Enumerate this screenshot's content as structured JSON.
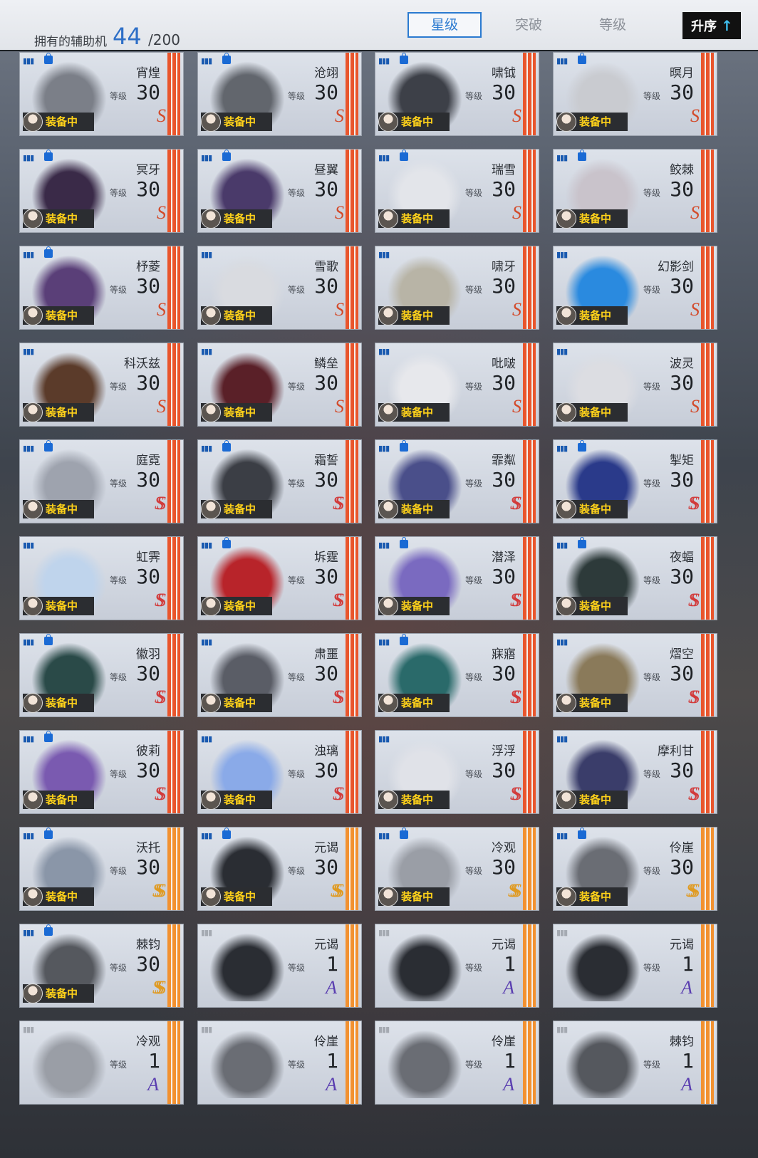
{
  "header": {
    "owned_label": "拥有的辅助机",
    "owned_count": "44",
    "owned_total": "/200",
    "tabs": [
      "星级",
      "突破",
      "等级"
    ],
    "active_tab": "星级",
    "sort_label": "升序",
    "sort_arrow": "↑"
  },
  "colors": {
    "accent": "#2a7ad0",
    "equip_text": "#ffd21a",
    "stripe_red": "#e9552c",
    "stripe_orange": "#f29130"
  },
  "level_label": "等级",
  "equip_label": "装备中",
  "cards": [
    {
      "name": "宵煌",
      "level": "30",
      "rank": "S",
      "equipped": true,
      "locked": true,
      "tint": "#7b7f88"
    },
    {
      "name": "沧翊",
      "level": "30",
      "rank": "S",
      "equipped": true,
      "locked": true,
      "tint": "#62666d"
    },
    {
      "name": "啸钺",
      "level": "30",
      "rank": "S",
      "equipped": true,
      "locked": true,
      "tint": "#3d4048"
    },
    {
      "name": "暝月",
      "level": "30",
      "rank": "S",
      "equipped": true,
      "locked": true,
      "tint": "#c9cbd0"
    },
    {
      "name": "冥牙",
      "level": "30",
      "rank": "S",
      "equipped": true,
      "locked": true,
      "tint": "#3a2a48"
    },
    {
      "name": "昼翼",
      "level": "30",
      "rank": "S",
      "equipped": true,
      "locked": true,
      "tint": "#4a3a6a"
    },
    {
      "name": "瑞雪",
      "level": "30",
      "rank": "S",
      "equipped": true,
      "locked": true,
      "tint": "#e3e5ea"
    },
    {
      "name": "鲛棘",
      "level": "30",
      "rank": "S",
      "equipped": true,
      "locked": true,
      "tint": "#c9c3cb"
    },
    {
      "name": "杼菱",
      "level": "30",
      "rank": "S",
      "equipped": true,
      "locked": true,
      "tint": "#5a3f78"
    },
    {
      "name": "雪歌",
      "level": "30",
      "rank": "S",
      "equipped": true,
      "locked": false,
      "tint": "#d9dbe0"
    },
    {
      "name": "啸牙",
      "level": "30",
      "rank": "S",
      "equipped": true,
      "locked": false,
      "tint": "#b8b4a6"
    },
    {
      "name": "幻影剑",
      "level": "30",
      "rank": "S",
      "equipped": true,
      "locked": false,
      "tint": "#2a8adf"
    },
    {
      "name": "科沃兹",
      "level": "30",
      "rank": "S",
      "equipped": true,
      "locked": false,
      "tint": "#5b3b2a"
    },
    {
      "name": "鳞垒",
      "level": "30",
      "rank": "S",
      "equipped": true,
      "locked": false,
      "tint": "#5a2028"
    },
    {
      "name": "吡啵",
      "level": "30",
      "rank": "S",
      "equipped": true,
      "locked": false,
      "tint": "#e7e8ec"
    },
    {
      "name": "波灵",
      "level": "30",
      "rank": "S",
      "equipped": true,
      "locked": false,
      "tint": "#dcdde2"
    },
    {
      "name": "庭霓",
      "level": "30",
      "rank": "SS",
      "equipped": true,
      "locked": true,
      "tint": "#9ea3ae"
    },
    {
      "name": "霜誓",
      "level": "30",
      "rank": "SS",
      "equipped": true,
      "locked": true,
      "tint": "#3b3e45"
    },
    {
      "name": "霏粼",
      "level": "30",
      "rank": "SS",
      "equipped": true,
      "locked": true,
      "tint": "#4a4f8a"
    },
    {
      "name": "掣矩",
      "level": "30",
      "rank": "SS",
      "equipped": true,
      "locked": true,
      "tint": "#2a3a8a"
    },
    {
      "name": "虹霁",
      "level": "30",
      "rank": "SS",
      "equipped": true,
      "locked": false,
      "tint": "#bfd4ec"
    },
    {
      "name": "坼霆",
      "level": "30",
      "rank": "SS",
      "equipped": true,
      "locked": true,
      "tint": "#b8242a"
    },
    {
      "name": "潜泽",
      "level": "30",
      "rank": "SS",
      "equipped": true,
      "locked": true,
      "tint": "#7a6ac0"
    },
    {
      "name": "夜蝠",
      "level": "30",
      "rank": "SS",
      "equipped": true,
      "locked": true,
      "tint": "#2d3a3a"
    },
    {
      "name": "徽羽",
      "level": "30",
      "rank": "SS",
      "equipped": true,
      "locked": true,
      "tint": "#2a4a48"
    },
    {
      "name": "肃噩",
      "level": "30",
      "rank": "SS",
      "equipped": true,
      "locked": false,
      "tint": "#5a5d66"
    },
    {
      "name": "寐寤",
      "level": "30",
      "rank": "SS",
      "equipped": true,
      "locked": true,
      "tint": "#2a6a6a"
    },
    {
      "name": "熠空",
      "level": "30",
      "rank": "SS",
      "equipped": true,
      "locked": false,
      "tint": "#8a7a5a"
    },
    {
      "name": "彼莉",
      "level": "30",
      "rank": "SS",
      "equipped": true,
      "locked": true,
      "tint": "#7a5ab0"
    },
    {
      "name": "浊璃",
      "level": "30",
      "rank": "SS",
      "equipped": true,
      "locked": false,
      "tint": "#8aaae8"
    },
    {
      "name": "浮浮",
      "level": "30",
      "rank": "SS",
      "equipped": true,
      "locked": false,
      "tint": "#e0e2e8"
    },
    {
      "name": "摩利甘",
      "level": "30",
      "rank": "SS",
      "equipped": true,
      "locked": false,
      "tint": "#3a3d6a"
    },
    {
      "name": "沃托",
      "level": "30",
      "rank": "SSS",
      "equipped": true,
      "locked": true,
      "tint": "#8a96a8"
    },
    {
      "name": "元谒",
      "level": "30",
      "rank": "SSS",
      "equipped": true,
      "locked": true,
      "tint": "#2a2d33"
    },
    {
      "name": "冷观",
      "level": "30",
      "rank": "SSS",
      "equipped": true,
      "locked": true,
      "tint": "#9a9ea6"
    },
    {
      "name": "伶崖",
      "level": "30",
      "rank": "SSS",
      "equipped": true,
      "locked": true,
      "tint": "#6a6d74"
    },
    {
      "name": "棘钧",
      "level": "30",
      "rank": "SSS",
      "equipped": true,
      "locked": true,
      "tint": "#55585e"
    },
    {
      "name": "元谒",
      "level": "1",
      "rank": "A",
      "equipped": false,
      "locked": false,
      "tint": "#2a2d33"
    },
    {
      "name": "元谒",
      "level": "1",
      "rank": "A",
      "equipped": false,
      "locked": false,
      "tint": "#2a2d33"
    },
    {
      "name": "元谒",
      "level": "1",
      "rank": "A",
      "equipped": false,
      "locked": false,
      "tint": "#2a2d33"
    },
    {
      "name": "冷观",
      "level": "1",
      "rank": "A",
      "equipped": false,
      "locked": false,
      "tint": "#9a9ea6"
    },
    {
      "name": "伶崖",
      "level": "1",
      "rank": "A",
      "equipped": false,
      "locked": false,
      "tint": "#6a6d74"
    },
    {
      "name": "伶崖",
      "level": "1",
      "rank": "A",
      "equipped": false,
      "locked": false,
      "tint": "#6a6d74"
    },
    {
      "name": "棘钧",
      "level": "1",
      "rank": "A",
      "equipped": false,
      "locked": false,
      "tint": "#55585e"
    }
  ]
}
